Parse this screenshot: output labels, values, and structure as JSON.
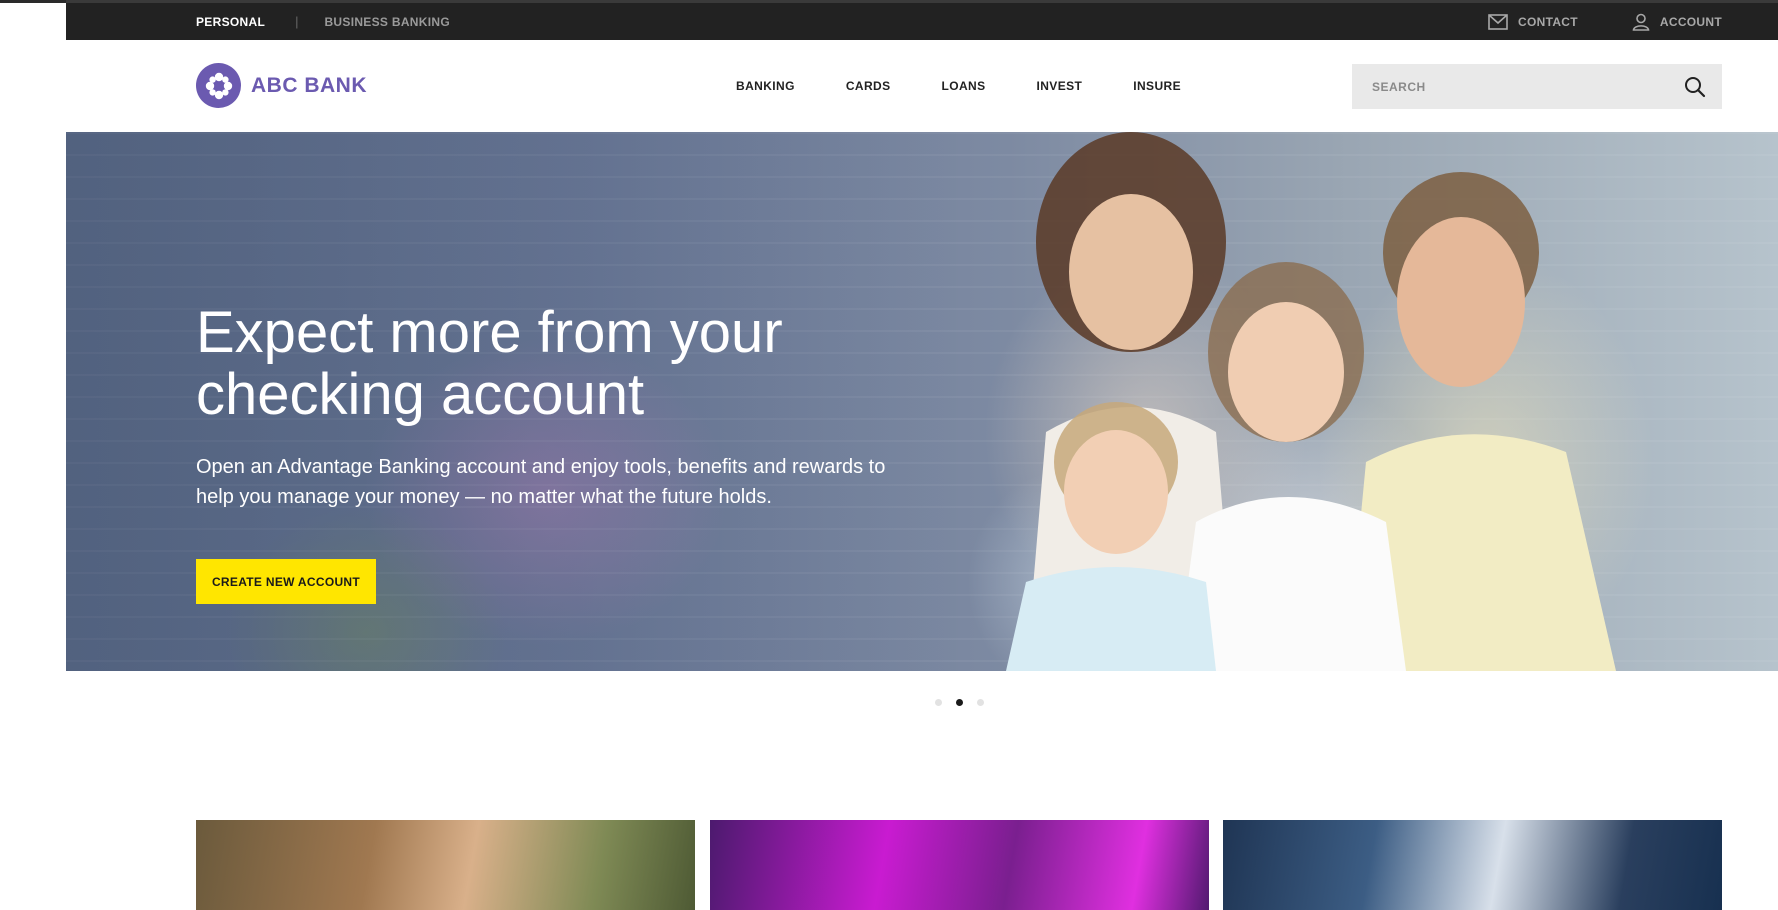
{
  "utility_bar": {
    "segments": [
      {
        "label": "PERSONAL"
      },
      {
        "label": "BUSINESS BANKING"
      }
    ],
    "separator": "|",
    "contact_label": "CONTACT",
    "account_label": "ACCOUNT"
  },
  "header": {
    "logo_text": "ABC BANK",
    "nav": [
      "BANKING",
      "CARDS",
      "LOANS",
      "INVEST",
      "INSURE"
    ],
    "search": {
      "placeholder": "SEARCH",
      "value": ""
    }
  },
  "hero": {
    "title_line1": "Expect more from your",
    "title_line2": "checking account",
    "subtitle_line1": "Open an Advantage Banking account and enjoy tools, benefits and rewards to",
    "subtitle_line2": "help you manage your money — no matter what the future holds.",
    "cta_label": "CREATE NEW ACCOUNT"
  },
  "carousel": {
    "slide_count": 3,
    "active_slide": 2
  },
  "colors": {
    "brand_purple": "#6b5ab0",
    "cta_yellow": "#ffe600",
    "utility_bar_bg": "#222222",
    "search_bg": "#e9e9e9"
  },
  "icons": {
    "contact": "mail-icon",
    "account": "user-icon",
    "search": "search-icon",
    "logo": "snowflake-logo-icon"
  }
}
